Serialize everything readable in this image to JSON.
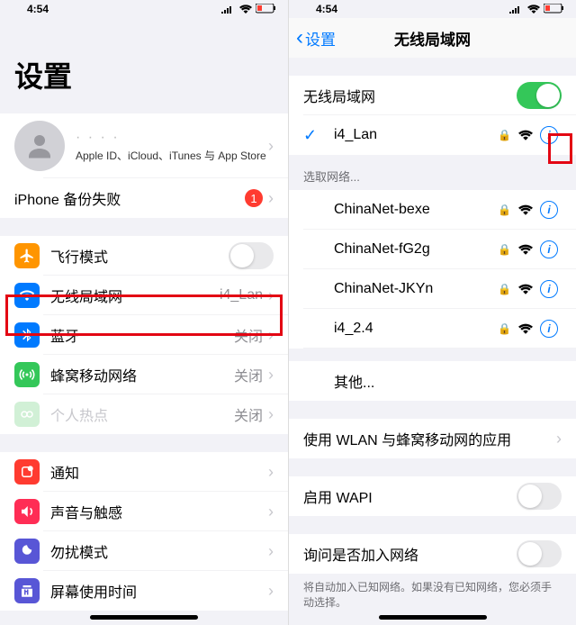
{
  "status": {
    "time": "4:54"
  },
  "left": {
    "title": "设置",
    "profile": {
      "sub": "Apple ID、iCloud、iTunes 与 App Store"
    },
    "backup": {
      "label": "iPhone 备份失败",
      "badge": "1"
    },
    "rows": {
      "airplane": "飞行模式",
      "wifi": "无线局域网",
      "wifi_detail": "i4_Lan",
      "bluetooth": "蓝牙",
      "bluetooth_detail": "关闭",
      "cellular": "蜂窝移动网络",
      "cellular_detail": "关闭",
      "hotspot": "个人热点",
      "hotspot_detail": "关闭",
      "notifications": "通知",
      "sounds": "声音与触感",
      "dnd": "勿扰模式",
      "screentime": "屏幕使用时间"
    }
  },
  "right": {
    "back": "设置",
    "title": "无线局域网",
    "wifi_label": "无线局域网",
    "connected": "i4_Lan",
    "choose": "选取网络...",
    "nets": [
      {
        "name": "ChinaNet-bexe"
      },
      {
        "name": "ChinaNet-fG2g"
      },
      {
        "name": "ChinaNet-JKYn"
      },
      {
        "name": "i4_2.4"
      }
    ],
    "other": "其他...",
    "apps": "使用 WLAN 与蜂窝移动网的应用",
    "wapi": "启用 WAPI",
    "ask": "询问是否加入网络",
    "ask_footer": "将自动加入已知网络。如果没有已知网络，您必须手动选择。"
  }
}
